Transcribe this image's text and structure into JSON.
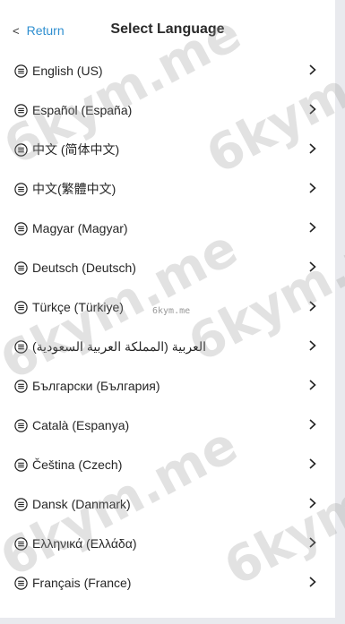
{
  "header": {
    "back_icon": "<",
    "back_label": "Return",
    "title": "Select Language"
  },
  "languages": [
    {
      "label": "English (US)"
    },
    {
      "label": "Español (España)"
    },
    {
      "label": "中文 (简体中文)"
    },
    {
      "label": "中文(繁體中文)"
    },
    {
      "label": "Magyar (Magyar)"
    },
    {
      "label": "Deutsch (Deutsch)"
    },
    {
      "label": "Türkçe (Türkiye)"
    },
    {
      "label": "العربية (المملكة العربية السعودية)"
    },
    {
      "label": "Български (България)"
    },
    {
      "label": "Català (Espanya)"
    },
    {
      "label": "Čeština (Czech)"
    },
    {
      "label": "Dansk (Danmark)"
    },
    {
      "label": "Ελληνικά (Ελλάδα)"
    },
    {
      "label": "Français (France)"
    }
  ],
  "icons": {
    "row_icon": "list-lines-icon",
    "row_arrow": "chevron-right-icon"
  },
  "watermark": {
    "text": "6kym.me",
    "small_text": "6kym.me"
  },
  "colors": {
    "accent": "#2f8fd0",
    "text": "#262626",
    "background": "#e9eaee"
  }
}
